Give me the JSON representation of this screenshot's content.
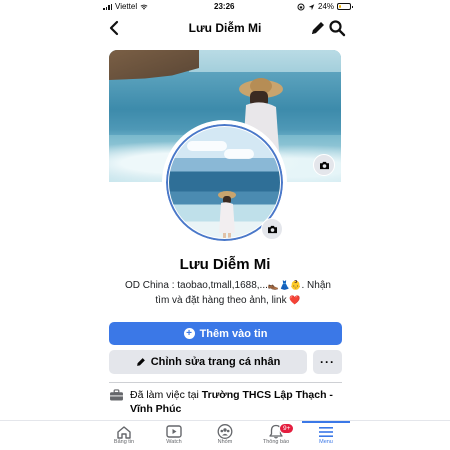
{
  "status_bar": {
    "carrier": "Viettel",
    "time": "23:26",
    "battery": "24%",
    "battery_level": 0.24
  },
  "header": {
    "title": "Lưu Diễm Mi",
    "back_icon": "chevron-left-icon",
    "edit_icon": "pencil-icon",
    "search_icon": "search-icon"
  },
  "profile": {
    "name": "Lưu Diễm Mi",
    "bio_line1": "OD China : taobao,tmall,1688,...",
    "bio_emoji": "👞👗👶",
    "bio_line1_end": ". Nhận",
    "bio_line2": "tìm và đặt hàng theo ảnh, link",
    "bio_heart": "❤️"
  },
  "actions": {
    "add_story": "Thêm vào tin",
    "edit_profile": "Chỉnh sửa trang cá nhân",
    "more": "···"
  },
  "details": {
    "work_prefix": "Đã làm việc tại ",
    "work_place": "Trường THCS Lập Thạch - Vĩnh Phúc"
  },
  "bottom_nav": {
    "items": [
      {
        "label": "Bảng tin",
        "icon": "home-icon"
      },
      {
        "label": "Watch",
        "icon": "watch-icon"
      },
      {
        "label": "Nhóm",
        "icon": "groups-icon"
      },
      {
        "label": "Thông báo",
        "icon": "bell-icon",
        "badge": "9+"
      },
      {
        "label": "Menu",
        "icon": "menu-icon",
        "active": true
      }
    ]
  },
  "colors": {
    "accent": "#3b78e7",
    "badge": "#e41e3f",
    "secondary_button": "#e4e6eb"
  }
}
